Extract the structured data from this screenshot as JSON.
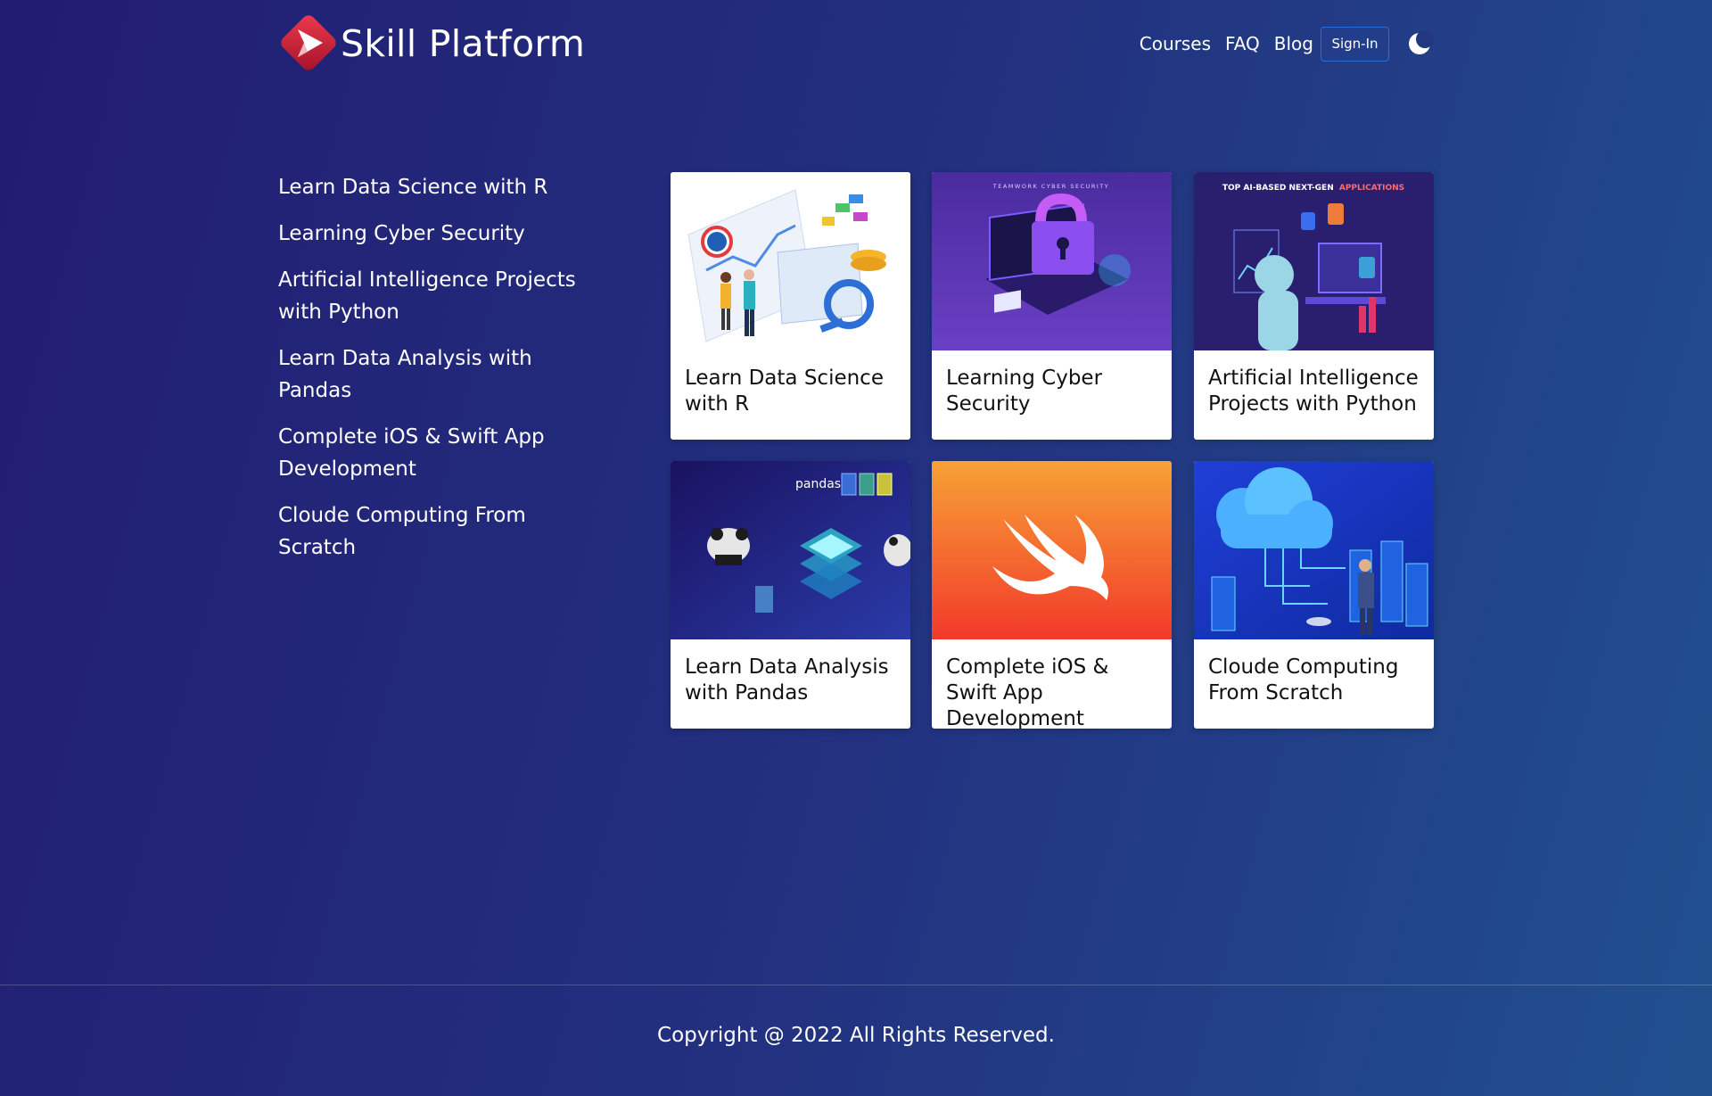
{
  "brand": {
    "name": "Skill Platform",
    "logo_icon": "play-diamond-logo"
  },
  "nav": {
    "links": [
      "Courses",
      "FAQ",
      "Blog"
    ],
    "signin_label": "Sign-In",
    "theme_icon": "moon-icon"
  },
  "sidebar": {
    "items": [
      {
        "label": "Learn Data Science with R"
      },
      {
        "label": "Learning Cyber Security"
      },
      {
        "label": "Artificial Intelligence Projects with Python"
      },
      {
        "label": "Learn Data Analysis with Pandas"
      },
      {
        "label": "Complete iOS & Swift App Development"
      },
      {
        "label": "Cloude Computing From Scratch"
      }
    ]
  },
  "cards": [
    {
      "title": "Learn Data Science with R",
      "image": "data-science-illustration"
    },
    {
      "title": "Learning Cyber Security",
      "image": "cyber-security-illustration",
      "image_caption": "TEAMWORK CYBER SECURITY"
    },
    {
      "title": "Artificial Intelligence Projects with Python",
      "image": "ai-robot-illustration",
      "image_caption_a": "TOP AI-BASED NEXT-GEN",
      "image_caption_b": "APPLICATIONS"
    },
    {
      "title": "Learn Data Analysis with Pandas",
      "image": "pandas-illustration",
      "image_caption": "pandas"
    },
    {
      "title": "Complete iOS & Swift App Development",
      "image": "swift-logo"
    },
    {
      "title": "Cloude Computing From Scratch",
      "image": "cloud-computing-illustration"
    }
  ],
  "colors": {
    "background_start": "#221c72",
    "background_end": "#21508f",
    "signin_border": "#2b6cd6",
    "logo_red": "#e0283c",
    "swift_orange": "#f7a236",
    "swift_red": "#f2392a"
  },
  "footer": {
    "copyright": "Copyright @ 2022 All Rights Reserved."
  }
}
